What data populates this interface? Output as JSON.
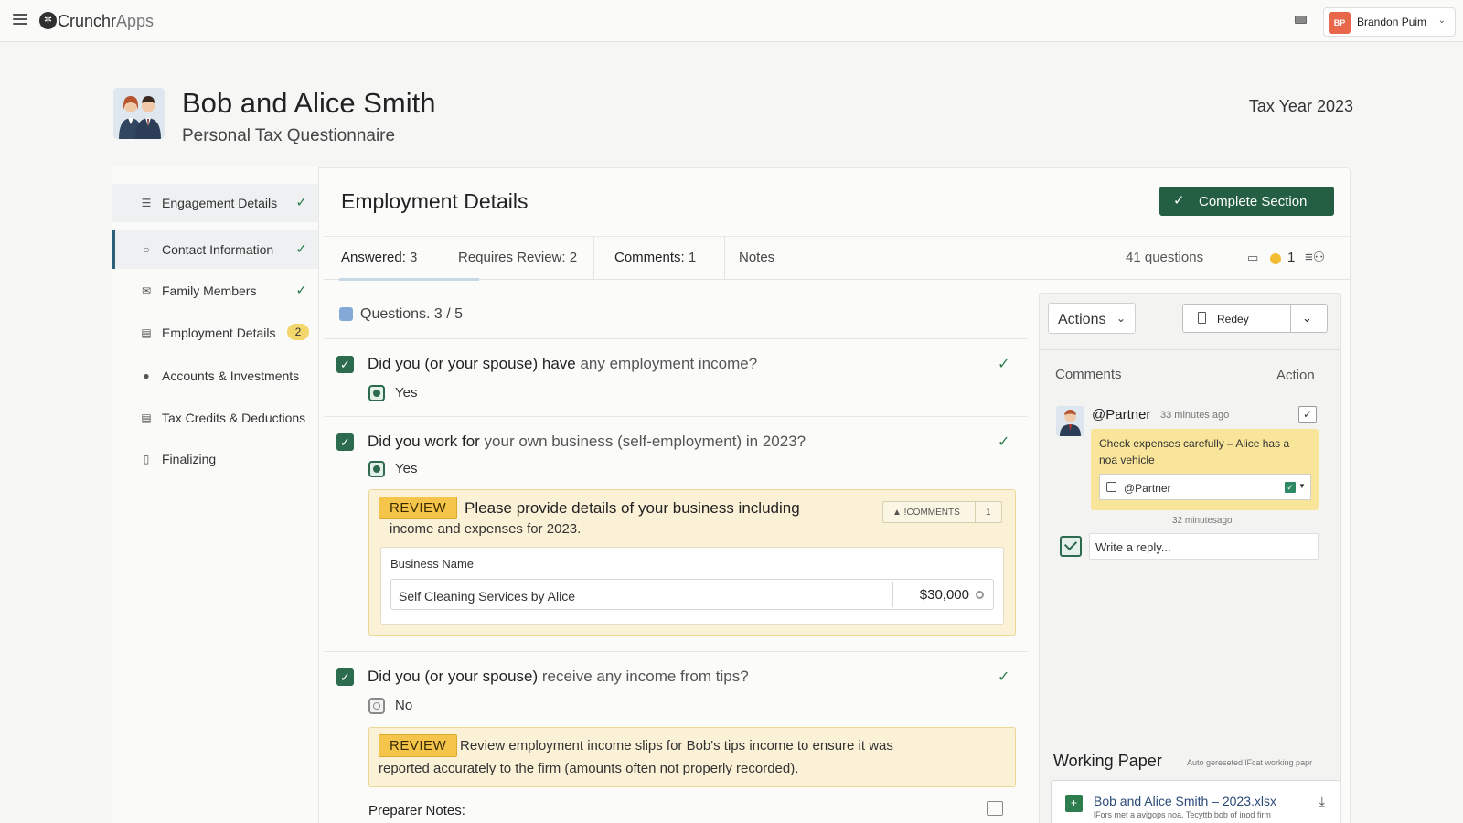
{
  "app": {
    "brand_prefix": "Crunchr",
    "brand_suffix": "Apps",
    "user": {
      "initials": "BP",
      "name": "Brandon Puim"
    }
  },
  "client": {
    "name": "Bob and Alice Smith",
    "subtitle": "Personal Tax Questionnaire",
    "tax_year": "Tax Year 2023"
  },
  "sidebar": {
    "items": [
      {
        "label": "Engagement Details",
        "icon": "list-icon",
        "status": "done"
      },
      {
        "label": "Contact Information",
        "icon": "search-person-icon",
        "status": "done"
      },
      {
        "label": "Family Members",
        "icon": "envelope-icon",
        "status": "done"
      },
      {
        "label": "Employment Details",
        "icon": "document-icon",
        "badge": "2"
      },
      {
        "label": "Accounts & Investments",
        "icon": "person-icon"
      },
      {
        "label": "Tax Credits & Deductions",
        "icon": "document-icon"
      },
      {
        "label": "Finalizing",
        "icon": "clipboard-icon"
      }
    ]
  },
  "section": {
    "title": "Employment Details",
    "complete_label": "Complete Section"
  },
  "tabs": {
    "answered_label": "Answered:",
    "answered_count": "3",
    "review_label": "Requires Review:",
    "review_count": "2",
    "comments_label": "Comments:",
    "comments_count": "1",
    "notes_label": "Notes",
    "question_total": "41 questions",
    "flag_count": "1"
  },
  "questions": {
    "header": "Questions. 3 / 5",
    "q1": {
      "bold": "Did you (or your spouse) have",
      "rest": " any employment income?",
      "answer": "Yes"
    },
    "q2": {
      "bold": "Did you work for",
      "rest": " your own business (self-employment) in 2023?",
      "answer": "Yes",
      "review_tag": "REVIEW",
      "review_line1": "Please provide details of your business including",
      "review_line2": "income and expenses for 2023.",
      "comments_badge_label": "▲ !COMMENTS",
      "comments_badge_count": "1",
      "business_label": "Business Name",
      "business_value": "Self Cleaning Services by Alice",
      "business_amount": "$30,000"
    },
    "q3": {
      "bold": "Did you (or your spouse)",
      "rest": " receive any income from tips?",
      "answer": "No",
      "review_tag": "REVIEW",
      "review_line1": "Review employment income slips for Bob's tips income to ensure it was",
      "review_line2": "reported accurately to the firm (amounts often not properly recorded)."
    },
    "preparer_notes_label": "Preparer Notes:"
  },
  "right_panel": {
    "actions_label": "Actions",
    "redey_label": "Redey",
    "comments_heading": "Comments",
    "action_heading": "Action",
    "comment": {
      "author": "@Partner",
      "time": "33 minutes ago",
      "text": "Check expenses carefully – Alice has a noa vehicle",
      "mention": "@Partner",
      "footer_time": "32 minutesago"
    },
    "reply_placeholder": "Write a reply...",
    "working_paper": {
      "title": "Working Paper",
      "subtitle": "Auto gereseted lFcat working papr",
      "file_name": "Bob and Alice Smith – 2023.xlsx",
      "file_meta": "lFors met a avigops noa. Tecyttb bob of inod firm"
    }
  },
  "colors": {
    "accent_green": "#245f43",
    "review_yellow": "#f4c54a",
    "comment_yellow": "#f9e59a",
    "avatar_orange": "#e8674a"
  }
}
